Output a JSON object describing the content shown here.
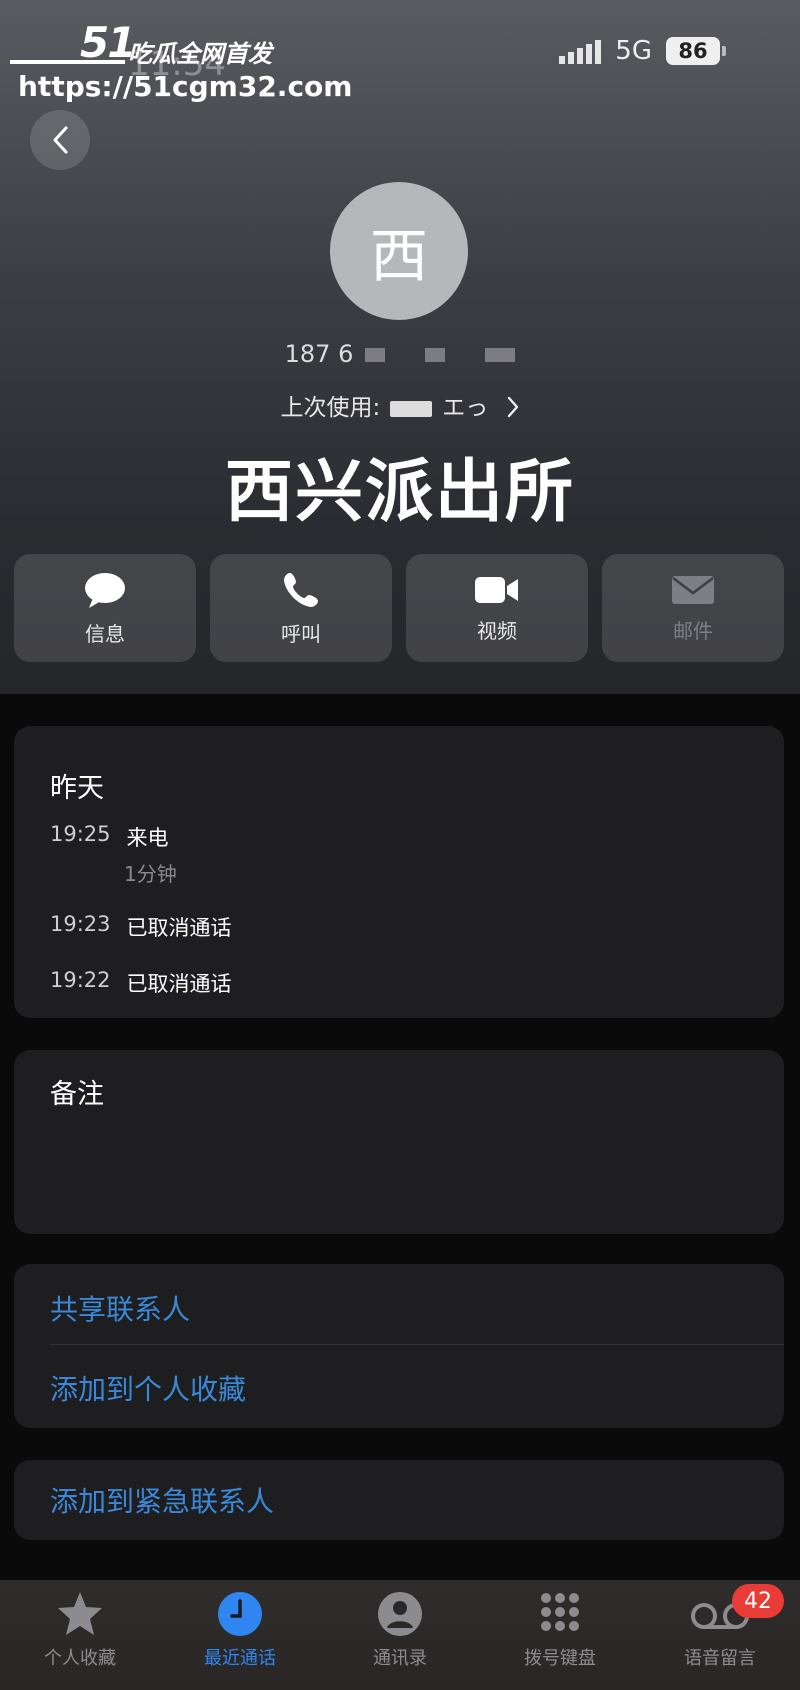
{
  "watermark": {
    "logo": "51",
    "title": "吃瓜全网首发",
    "url": "https://51cgm32.com"
  },
  "status": {
    "time": "11:54",
    "network": "5G",
    "battery": "86"
  },
  "contact": {
    "avatar_initial": "西",
    "phone_prefix": "187 6",
    "last_used_label": "上次使用:",
    "last_used_value": "エっ",
    "name": "西兴派出所"
  },
  "actions": [
    {
      "label": "信息",
      "icon": "message-icon"
    },
    {
      "label": "呼叫",
      "icon": "phone-icon"
    },
    {
      "label": "视频",
      "icon": "video-icon"
    },
    {
      "label": "邮件",
      "icon": "mail-icon"
    }
  ],
  "recent": {
    "title": "昨天",
    "calls": [
      {
        "time": "19:25",
        "type": "来电",
        "duration": "1分钟"
      },
      {
        "time": "19:23",
        "type": "已取消通话"
      },
      {
        "time": "19:22",
        "type": "已取消通话"
      }
    ]
  },
  "notes": {
    "title": "备注"
  },
  "links": {
    "share": "共享联系人",
    "favorite": "添加到个人收藏",
    "emergency": "添加到紧急联系人"
  },
  "tabs": [
    {
      "label": "个人收藏",
      "icon": "star-icon"
    },
    {
      "label": "最近通话",
      "icon": "clock-icon",
      "active": true
    },
    {
      "label": "通讯录",
      "icon": "contacts-icon"
    },
    {
      "label": "拨号键盘",
      "icon": "keypad-icon"
    },
    {
      "label": "语音留言",
      "icon": "voicemail-icon",
      "badge": "42"
    }
  ],
  "colors": {
    "accent": "#2f86f0",
    "link": "#3b88d8",
    "badge": "#ea3c36"
  }
}
